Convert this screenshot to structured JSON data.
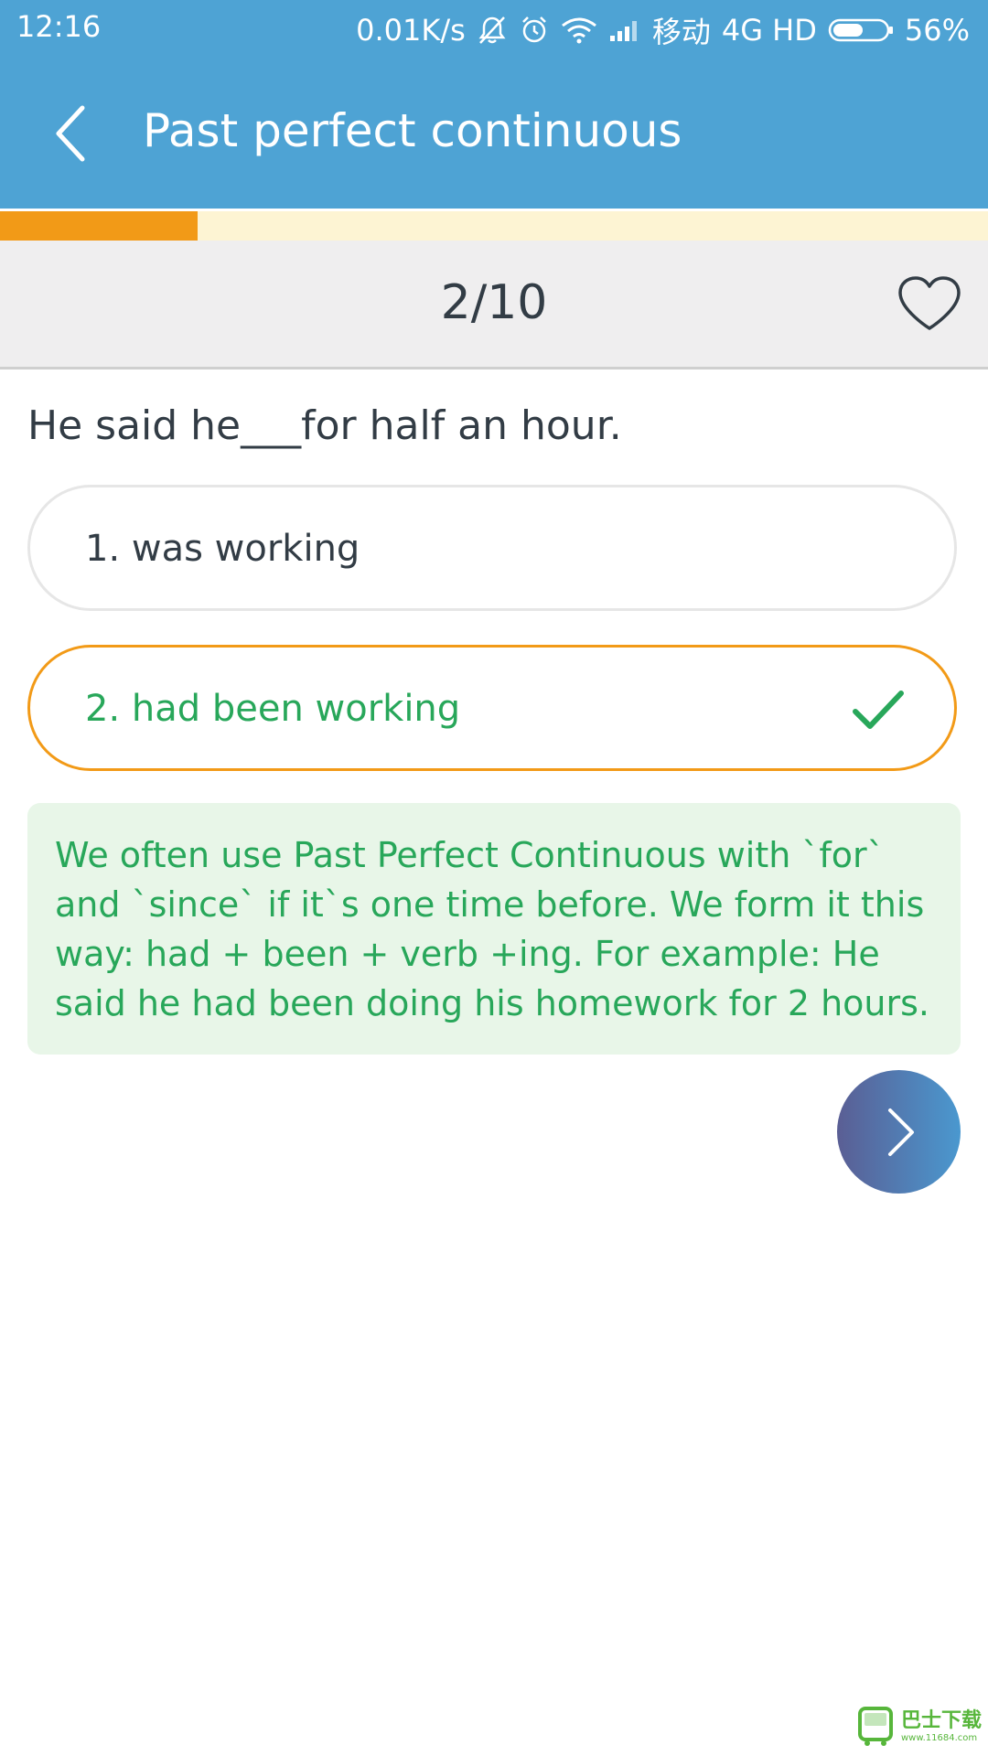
{
  "status_bar": {
    "time": "12:16",
    "network_speed": "0.01K/s",
    "carrier": "移动",
    "network_type": "4G HD",
    "battery": "56%",
    "icons": [
      "mute-icon",
      "alarm-icon",
      "wifi-icon",
      "signal-icon",
      "battery-icon"
    ]
  },
  "header": {
    "title": "Past perfect continuous",
    "back_icon": "chevron-left-icon",
    "background_color": "#4ea3d4"
  },
  "progress": {
    "current": 2,
    "total": 10,
    "fraction": 0.2,
    "fill_color": "#f29a17",
    "track_color": "#fdf4d3"
  },
  "counter": {
    "label": "2/10",
    "favorite_icon": "heart-outline-icon"
  },
  "question": {
    "text": "He said he___for half an hour."
  },
  "options": [
    {
      "label": "1. was working",
      "state": "unselected"
    },
    {
      "label": "2. had been working",
      "state": "correct",
      "icon": "check-icon"
    }
  ],
  "explanation": {
    "text": "We often use Past Perfect Continuous with `for` and `since` if it`s one time before. We form it this way: had + been + verb +ing. For example: He said he had been doing his homework for 2 hours.",
    "text_color": "#28a75a",
    "background_color": "#e8f6e8"
  },
  "next_button": {
    "icon": "chevron-right-icon"
  },
  "watermark": {
    "text": "巴士下载",
    "url": "www.11684.com"
  }
}
